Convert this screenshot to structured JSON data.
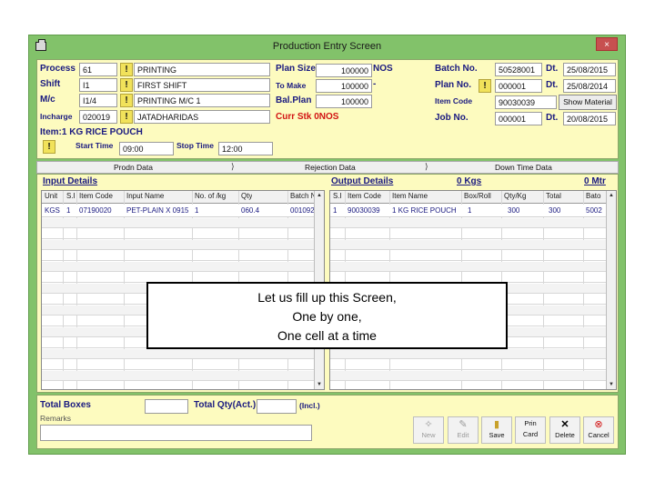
{
  "window": {
    "title": "Production Entry Screen",
    "close_glyph": "×"
  },
  "header": {
    "process_label": "Process",
    "process_code": "61",
    "process_name": "PRINTING",
    "shift_label": "Shift",
    "shift_code": "I1",
    "shift_name": "FIRST SHIFT",
    "mc_label": "M/c",
    "mc_code": "I1/4",
    "mc_name": "PRINTING M/C 1",
    "incharge_label": "Incharge",
    "incharge_code": "020019",
    "incharge_name": "JATADHARIDAS",
    "plan_size_label": "Plan Size",
    "plan_size_value": "100000",
    "plan_size_unit": "NOS",
    "to_make_label": "To Make",
    "to_make_value": "100000",
    "to_make_unit": "-",
    "bal_plan_label": "Bal.Plan",
    "bal_plan_value": "100000",
    "curr_stk": "Curr Stk 0NOS",
    "batch_label": "Batch No.",
    "batch_value": "50528001",
    "batch_dt_label": "Dt.",
    "batch_dt": "25/08/2015",
    "plan_no_label": "Plan No.",
    "plan_no_value": "000001",
    "plan_dt_label": "Dt.",
    "plan_dt": "25/08/2014",
    "item_code_label": "Item Code",
    "item_code_value": "90030039",
    "show_material": "Show Material",
    "job_no_label": "Job No.",
    "job_no_value": "000001",
    "job_dt_label": "Dt.",
    "job_dt": "20/08/2015",
    "item_line": "Item:1 KG RICE POUCH",
    "start_time_label": "Start Time",
    "start_time": "09:00",
    "stop_time_label": "Stop Time",
    "stop_time": "12:00",
    "warn_glyph": "!"
  },
  "tabs": [
    "Prodn Data",
    "Rejection Data",
    "Down Time Data"
  ],
  "input": {
    "title": "Input Details",
    "headers": [
      "Unit",
      "S.I",
      "Item Code",
      "Input Name",
      "No. of /kg",
      "Qty",
      "Batch N"
    ],
    "row": [
      "KGS",
      "1",
      "07190020",
      "PET-PLAIN X 0915",
      "1",
      "060.4",
      "001092"
    ]
  },
  "output": {
    "title": "Output Details",
    "kgs": "0 Kgs",
    "mtr": "0 Mtr",
    "headers": [
      "S.I",
      "Item Code",
      "Item Name",
      "Box/Roll",
      "Qty/Kg",
      "Total",
      "Bato"
    ],
    "row": [
      "1",
      "90030039",
      "1 KG RICE POUCH",
      "1",
      "300",
      "300",
      "5002"
    ]
  },
  "overlay": {
    "line1": "Let us fill up this Screen,",
    "line2": "One by one,",
    "line3": "One cell at a time"
  },
  "footer": {
    "total_boxes_label": "Total Boxes",
    "total_qty_label": "Total Qty(Act.)",
    "incl_label": "(Incl.)",
    "remarks_label": "Remarks",
    "buttons": {
      "new": "New",
      "edit": "Edit",
      "save": "Save",
      "print_line1": "Prin",
      "print_line2": "Card",
      "delete": "Delete",
      "cancel": "Cancel"
    }
  },
  "colors": {
    "window_green": "#82c26a",
    "panel_yellow": "#fdfbbf",
    "label_blue": "#1a1a80",
    "alert_red": "#d21414"
  }
}
